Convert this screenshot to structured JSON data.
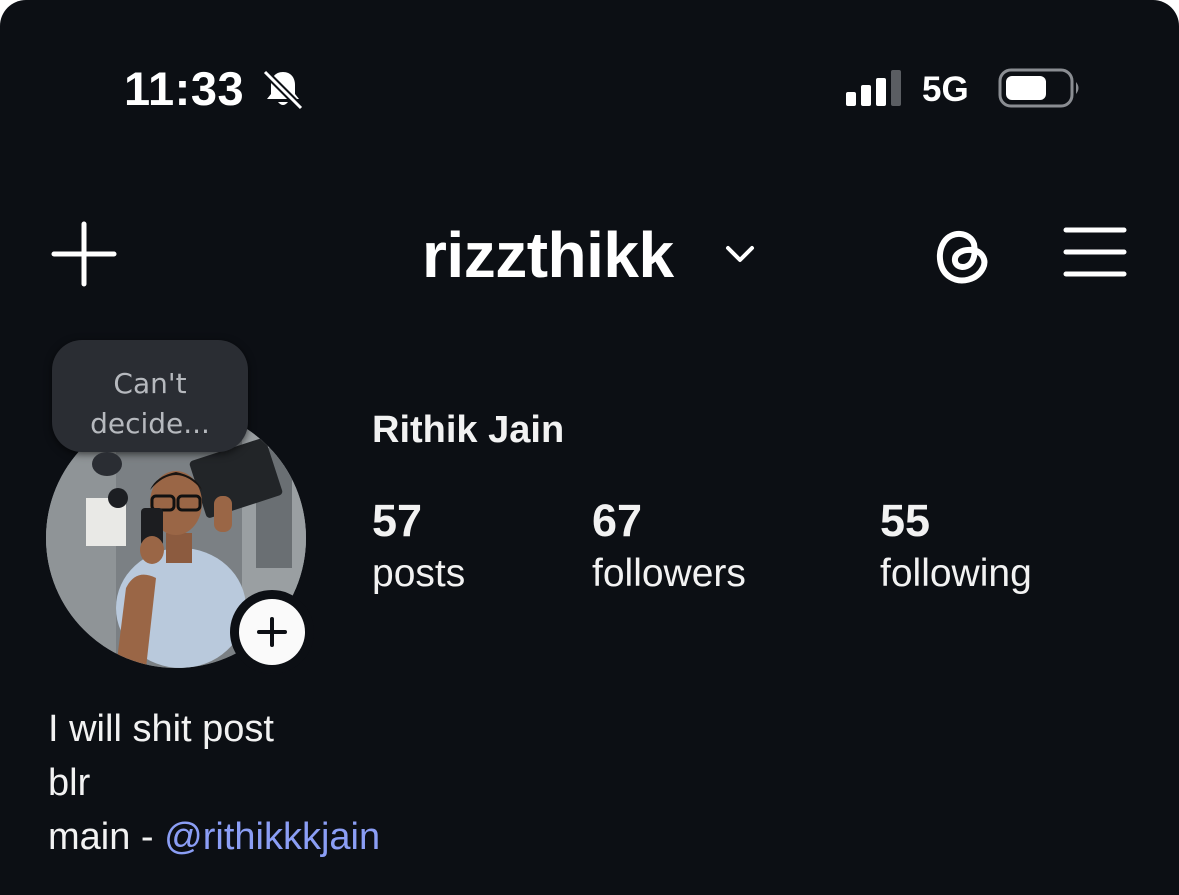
{
  "status_bar": {
    "time": "11:33",
    "network": "5G",
    "icons": [
      "bell-slash-icon",
      "signal-icon",
      "battery-icon"
    ]
  },
  "header": {
    "username": "rizzthikk",
    "icons": [
      "plus-icon",
      "chevron-down-icon",
      "threads-icon",
      "hamburger-menu-icon"
    ]
  },
  "note": {
    "text": "Can't\ndecide..."
  },
  "profile": {
    "full_name": "Rithik Jain",
    "stats": [
      {
        "value": "57",
        "label": "posts"
      },
      {
        "value": "67",
        "label": "followers"
      },
      {
        "value": "55",
        "label": "following"
      }
    ]
  },
  "bio": {
    "line1": "I will shit post",
    "line2": "blr",
    "line3_prefix": "main - ",
    "line3_mention": "@rithikkkjain"
  },
  "colors": {
    "background": "#0c0f14",
    "text": "#f2f2f2",
    "mention": "#8b9ef5",
    "note_bubble": "#2a2d33"
  }
}
